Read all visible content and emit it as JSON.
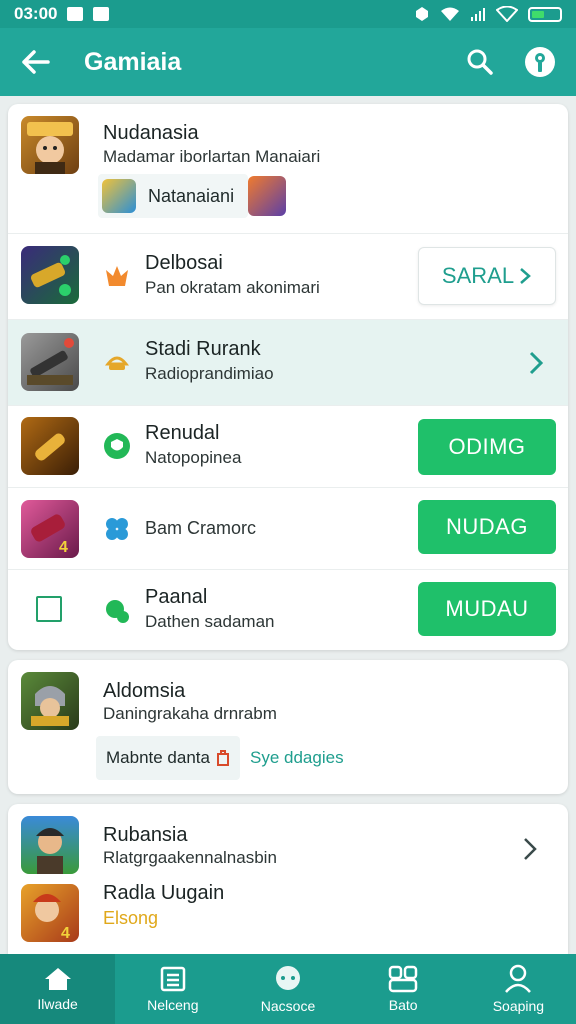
{
  "status": {
    "time": "03:00"
  },
  "appbar": {
    "title": "Gamiaia"
  },
  "card1": {
    "header": {
      "title": "Nudanasia",
      "subtitle": "Madamar iborlartan Manaiari",
      "chip": "Natanaiani"
    },
    "rows": [
      {
        "title": "Delbosai",
        "subtitle": "Pan okratam akonimari",
        "button": "SARAL",
        "button_style": "outline"
      },
      {
        "title": "Stadi Rurank",
        "subtitle": "Radioprandimiao",
        "button": "",
        "button_style": "chevron",
        "highlighted": true
      },
      {
        "title": "Renudal",
        "subtitle": "Natopopinea",
        "button": "ODIMG",
        "button_style": "green"
      },
      {
        "title": "",
        "subtitle": "Bam Cramorc",
        "button": "NUDAG",
        "button_style": "green"
      },
      {
        "title": "Paanal",
        "subtitle": "Dathen sadaman",
        "button": "MUDAU",
        "button_style": "green"
      }
    ]
  },
  "card2": {
    "title": "Aldomsia",
    "subtitle": "Daningrakaha drnrabm",
    "chip": "Mabnte danta",
    "link": "Sye ddagies"
  },
  "card3": {
    "rows": [
      {
        "title": "Rubansia",
        "subtitle": "Rlatgrgaakennalnasbin"
      },
      {
        "title": "Radla Uugain",
        "subtitle": "Elsong"
      }
    ]
  },
  "nav": [
    {
      "label": "Ilwade",
      "icon": "home-icon"
    },
    {
      "label": "Nelceng",
      "icon": "list-icon"
    },
    {
      "label": "Nacsoce",
      "icon": "chat-icon"
    },
    {
      "label": "Bato",
      "icon": "grid-icon"
    },
    {
      "label": "Soaping",
      "icon": "profile-icon"
    }
  ],
  "colors": {
    "primary": "#22a79a",
    "statusbar": "#1b9c8e",
    "accent_green": "#1fc06a",
    "highlight_row": "#e6f3f1"
  }
}
